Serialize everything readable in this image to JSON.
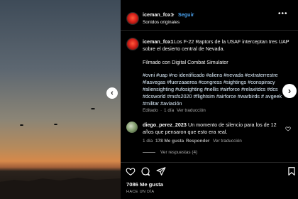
{
  "header": {
    "username": "iceman_fox1",
    "separator": "•",
    "follow_label": "Seguir",
    "audio": "Sonidos originales",
    "more_icon": "more-horizontal-icon"
  },
  "caption": {
    "username": "iceman_fox1",
    "line1": "Los F-22 Raptors de la USAF interceptan tres UAP",
    "line2": "sobre el desierto central de Nevada.",
    "line3": "Filmado con Digital Combat Simulator",
    "tags1": "#ovni #uap #no identificado #aliens #nevada #extraterrestre",
    "tags2": "#lasvegas #fuerzaaerea #congress #sightings #conspiracy",
    "tags3": "#aliensighting #ufosighting #nellis #airforce #relaxitdcs #dcs",
    "tags4": "#dcsworld #msfs2020 #flightsim #airforce #warbirds # avgeek",
    "tags5": "#militar #aviación",
    "meta_edited": "Editado",
    "meta_dot": "·",
    "meta_time": "1 día",
    "meta_translate": "Ver traducción"
  },
  "comment": {
    "username": "diego_perez_2023",
    "text1": "Un momento de silencio para los de 12",
    "text2": "años que pensaron que esto era real.",
    "time": "1 día",
    "likes": "178 Me gusta",
    "reply": "Responder",
    "translate": "Ver traducción",
    "replies": "Ver respuestas (4)"
  },
  "footer": {
    "likes": "7086 Me gusta",
    "time": "HACE UN DÍA"
  },
  "icons": {
    "like": "heart-icon",
    "comment": "comment-icon",
    "share": "send-icon",
    "save": "bookmark-icon"
  },
  "colors": {
    "accent": "#4aa3f0",
    "background": "#000000"
  }
}
